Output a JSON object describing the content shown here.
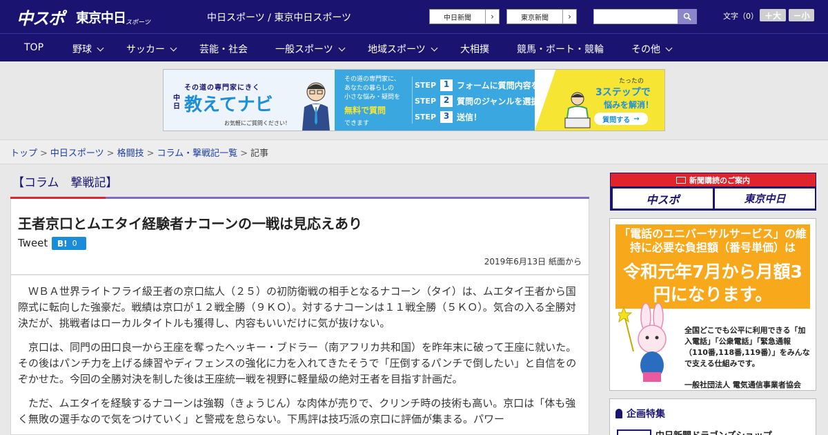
{
  "header": {
    "logo_chuspo": "中スポ",
    "logo_tokyo": "東京中日",
    "logo_tokyo_sub": "スポーツ",
    "site_title": "中日スポーツ / 東京中日スポーツ",
    "paper_links": [
      "中日新聞",
      "東京新聞"
    ],
    "search_placeholder": "",
    "font_label": "文字（0）",
    "font_up": "＋大",
    "font_down": "－小"
  },
  "nav": {
    "items": [
      {
        "label": "TOP",
        "dropdown": false
      },
      {
        "label": "野球",
        "dropdown": true
      },
      {
        "label": "サッカー",
        "dropdown": true
      },
      {
        "label": "芸能・社会",
        "dropdown": false
      },
      {
        "label": "一般スポーツ",
        "dropdown": true
      },
      {
        "label": "地域スポーツ",
        "dropdown": true
      },
      {
        "label": "大相撲",
        "dropdown": false
      },
      {
        "label": "競馬・ボート・競輪",
        "dropdown": false
      },
      {
        "label": "その他",
        "dropdown": true
      }
    ]
  },
  "ad_banner": {
    "left_small": "その道の専門家にきく",
    "left_brand_prefix": "中日",
    "left_brand": "教えてナビ",
    "left_note": "お気軽にご質問ください！",
    "mid_lines": [
      "その道の専門家に、",
      "あなたの暮らしの",
      "小さな悩み・疑問を"
    ],
    "mid_highlight": "無料で質問",
    "mid_tail": "できます",
    "steps": [
      {
        "label": "STEP",
        "num": "1",
        "text": "フォームに質問内容を入力"
      },
      {
        "label": "STEP",
        "num": "2",
        "text": "質問のジャンルを選択"
      },
      {
        "label": "STEP",
        "num": "3",
        "text": "送信！"
      }
    ],
    "right_top": "たったの",
    "right_big": "3ステップで",
    "right_sub": "悩みを解消！",
    "right_cta": "質問する"
  },
  "breadcrumb": {
    "items": [
      "トップ",
      "中日スポーツ",
      "格闘技",
      "コラム・撃戦記一覧"
    ],
    "current": "記事",
    "separator": ">"
  },
  "column_title": "【コラム　撃戦記】",
  "article": {
    "title": "王者京口とムエタイ経験者ナコーンの一戦は見応えあり",
    "tweet": "Tweet",
    "hatena_label": "B!",
    "hatena_count": "0",
    "date": "2019年6月13日 紙面から",
    "paragraphs": [
      "ＷＢＡ世界ライトフライ級王者の京口紘人（２５）の初防衛戦の相手となるナコーン（タイ）は、ムエタイ王者から国際式に転向した強豪だ。戦績は京口が１２戦全勝（９ＫＯ）。対するナコーンは１１戦全勝（５ＫＯ）。気合の入る全勝対決だが、挑戦者はローカルタイトルも獲得し、内容もいいだけに気が抜けない。",
      "京口は、同門の田口良一から王座を奪ったヘッキー・ブドラー（南アフリカ共和国）を昨年末に破って王座に就いた。その後はパンチ力を上げる練習やディフェンスの強化に力を入れてきたそうで「圧倒するパンチで倒したい」と自信をのぞかせた。今回の全勝対決を制した後は王座統一戦を視野に軽量級の絶対王者を目指す計画だ。",
      "ただ、ムエタイを経験するナコーンは強靱（きょうじん）な肉体が売りで、クリンチ時の技術も高い。京口は「体も強く無敗の選手なので気をつけていく」と警戒を怠らない。下馬評は技巧派の京口に評価が集まる。パワー"
    ]
  },
  "sidebar": {
    "subscribe_head": "新聞購読のご案内",
    "subscribe_logos": [
      "中スポ",
      "東京中日"
    ],
    "universal_ad": {
      "head1": "「電話のユニバーサルサービス」の維持に必要な負担額（番号単価）は",
      "head2": "令和元年7月から月額3円になります。",
      "body": "全国どこでも公平に利用できる「加入電話」「公衆電話」「緊急通報（110番,118番,119番）」をみんなで支える仕組みです。",
      "org": "一般社団法人 電気通信事業者協会"
    },
    "special": {
      "head": "企画特集",
      "item": "中日新聞ドラゴンズショップ"
    }
  },
  "colors": {
    "brand_navy": "#1a1470",
    "accent_red": "#e0242b",
    "accent_purple": "#7d6cc1",
    "link_blue": "#1a3fa0",
    "hatena_blue": "#1b8cd9",
    "ad_yellow": "#f6e633",
    "ad_blue": "#3aa7e0",
    "ad_orange": "#f7a81b"
  }
}
